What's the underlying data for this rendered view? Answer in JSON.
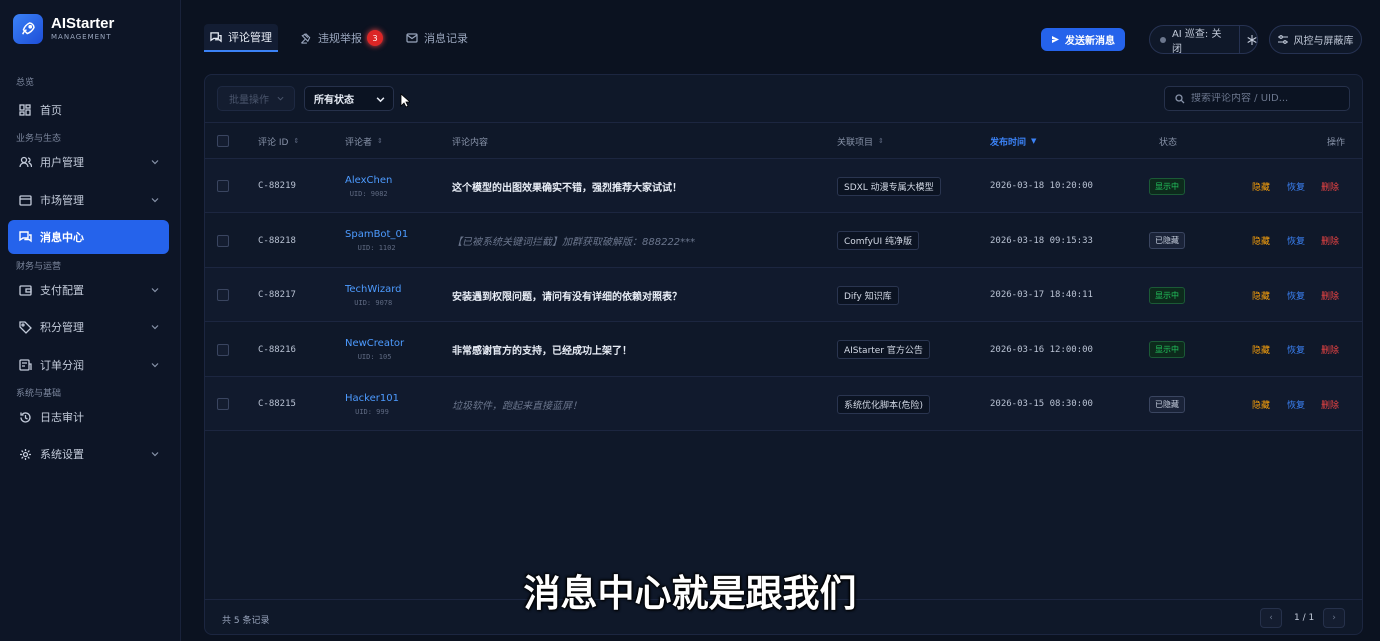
{
  "brand": {
    "name": "AIStarter",
    "sub": "MANAGEMENT"
  },
  "sidebar": {
    "sections": [
      "总览",
      "业务与生态",
      "财务与运营",
      "系统与基础"
    ],
    "items": [
      {
        "label": "首页",
        "icon": "dashboard-icon"
      },
      {
        "label": "用户管理",
        "icon": "users-icon"
      },
      {
        "label": "市场管理",
        "icon": "store-icon"
      },
      {
        "label": "消息中心",
        "icon": "chat-icon",
        "active": true
      },
      {
        "label": "支付配置",
        "icon": "wallet-icon"
      },
      {
        "label": "积分管理",
        "icon": "tag-icon"
      },
      {
        "label": "订单分润",
        "icon": "order-icon"
      },
      {
        "label": "日志审计",
        "icon": "history-icon"
      },
      {
        "label": "系统设置",
        "icon": "gear-icon"
      }
    ]
  },
  "tabs": [
    {
      "label": "评论管理",
      "icon": "comments-icon",
      "active": true
    },
    {
      "label": "违规举报",
      "icon": "gavel-icon",
      "badge": "3"
    },
    {
      "label": "消息记录",
      "icon": "mail-icon"
    }
  ],
  "topbar": {
    "send_label": "发送新消息",
    "ai_patrol_label": "AI 巡查: 关闭",
    "risk_label": "风控与屏蔽库"
  },
  "filters": {
    "batch_label": "批量操作",
    "status_label": "所有状态",
    "search_placeholder": "搜索评论内容 / UID..."
  },
  "table": {
    "headers": {
      "id": "评论 ID",
      "author": "评论者",
      "content": "评论内容",
      "project": "关联项目",
      "time": "发布时间",
      "status": "状态",
      "actions": "操作"
    },
    "action_labels": {
      "hide": "隐藏",
      "restore": "恢复",
      "delete": "删除"
    },
    "rows": [
      {
        "id": "C-88219",
        "name": "AlexChen",
        "uid": "UID: 9082",
        "content": "这个模型的出图效果确实不错，强烈推荐大家试试！",
        "blocked": false,
        "project": "SDXL 动漫专属大模型",
        "time": "2026-03-18 10:20:00",
        "status": "显示中"
      },
      {
        "id": "C-88218",
        "name": "SpamBot_01",
        "uid": "UID: 1102",
        "content": "【已被系统关键词拦截】加群获取破解版：888222***",
        "blocked": true,
        "project": "ComfyUI 纯净版",
        "time": "2026-03-18 09:15:33",
        "status": "已隐藏"
      },
      {
        "id": "C-88217",
        "name": "TechWizard",
        "uid": "UID: 9078",
        "content": "安装遇到权限问题，请问有没有详细的依赖对照表？",
        "blocked": false,
        "project": "Dify 知识库",
        "time": "2026-03-17 18:40:11",
        "status": "显示中"
      },
      {
        "id": "C-88216",
        "name": "NewCreator",
        "uid": "UID: 105",
        "content": "非常感谢官方的支持，已经成功上架了！",
        "blocked": false,
        "project": "AIStarter 官方公告",
        "time": "2026-03-16 12:00:00",
        "status": "显示中"
      },
      {
        "id": "C-88215",
        "name": "Hacker101",
        "uid": "UID: 999",
        "content": "垃圾软件，跑起来直接蓝屏！",
        "blocked": true,
        "project": "系统优化脚本(危险)",
        "time": "2026-03-15 08:30:00",
        "status": "已隐藏"
      }
    ]
  },
  "footer": {
    "total": "共 5 条记录",
    "page": "1 / 1"
  },
  "subtitle": "消息中心就是跟我们",
  "colors": {
    "accent": "#2563eb",
    "link": "#4d9bff",
    "warn": "#f59e0b",
    "danger": "#ef4444",
    "ok": "#22c55e"
  }
}
